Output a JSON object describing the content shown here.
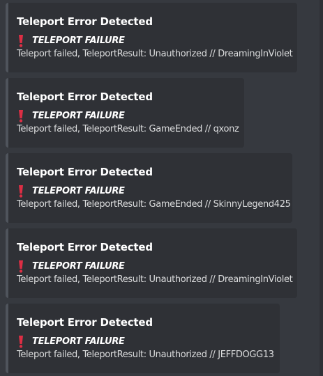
{
  "embeds": [
    {
      "title": "Teleport Error Detected",
      "icon": "exclamation-icon",
      "field_name": "TELEPORT FAILURE",
      "description": "Teleport failed, TeleportResult: Unauthorized // DreamingInViolet"
    },
    {
      "title": "Teleport Error Detected",
      "icon": "exclamation-icon",
      "field_name": "TELEPORT FAILURE",
      "description": "Teleport failed, TeleportResult: GameEnded // qxonz"
    },
    {
      "title": "Teleport Error Detected",
      "icon": "exclamation-icon",
      "field_name": "TELEPORT FAILURE",
      "description": "Teleport failed, TeleportResult: GameEnded // SkinnyLegend425"
    },
    {
      "title": "Teleport Error Detected",
      "icon": "exclamation-icon",
      "field_name": "TELEPORT FAILURE",
      "description": "Teleport failed, TeleportResult: Unauthorized // DreamingInViolet"
    },
    {
      "title": "Teleport Error Detected",
      "icon": "exclamation-icon",
      "field_name": "TELEPORT FAILURE",
      "description": "Teleport failed, TeleportResult: Unauthorized // JEFFDOGG13"
    }
  ],
  "colors": {
    "background": "#36393f",
    "embed_background": "#2f3136",
    "embed_border": "#4f545c",
    "exclamation": "#dd2e44"
  }
}
